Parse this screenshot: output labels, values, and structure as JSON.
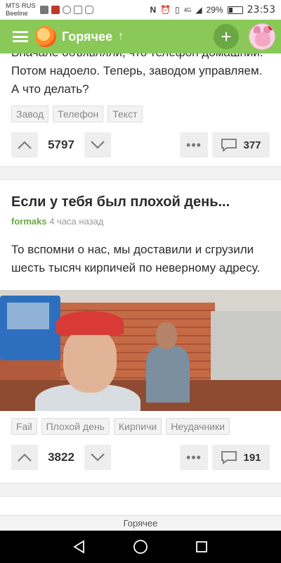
{
  "status_bar": {
    "carrier_1": "MTS RUS",
    "carrier_2": "Beeline",
    "network": "4G",
    "battery": "29%",
    "time": "23:53"
  },
  "app_bar": {
    "title": "Горячее",
    "plus_label": "+"
  },
  "post1": {
    "text_line_1": "Вначале объявляли, что телефон домашний.",
    "text_line_2": "Потом надоело. Теперь, заводом управляем.",
    "text_line_3": "А что делать?",
    "tags": [
      "Завод",
      "Телефон",
      "Текст"
    ],
    "rating": "5797",
    "comments": "377"
  },
  "post2": {
    "title": "Если у тебя был плохой день...",
    "author": "formaks",
    "time": "4 часа назад",
    "text_line_1": "То вспомни о нас, мы доставили и сгрузили",
    "text_line_2": "шесть тысяч кирпичей по неверному адресу.",
    "tags": [
      "Fail",
      "Плохой день",
      "Кирпичи",
      "Неудачники"
    ],
    "rating": "3822",
    "comments": "191"
  },
  "bottom_tab": {
    "label": "Горячее"
  },
  "colors": {
    "accent": "#8ac858",
    "author": "#6aa843",
    "nav": "#000000"
  }
}
